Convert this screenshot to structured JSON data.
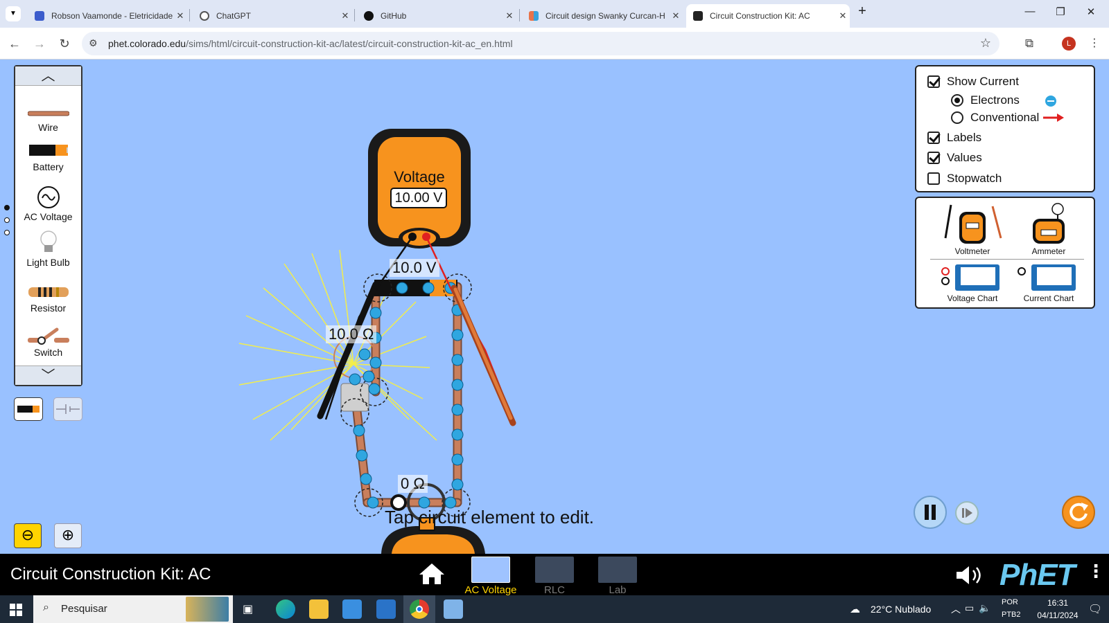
{
  "browser": {
    "tabs": [
      {
        "title": "Robson Vaamonde - Eletricidade",
        "favicon_color": "#3b5ccc"
      },
      {
        "title": "ChatGPT",
        "favicon_color": "#555555"
      },
      {
        "title": "GitHub",
        "favicon_color": "#111111"
      },
      {
        "title": "Circuit design Swanky Curcan-H",
        "favicon_color": "#e8734a"
      },
      {
        "title": "Circuit Construction Kit: AC",
        "favicon_color": "#222222"
      }
    ],
    "url_host": "phet.colorado.edu",
    "url_path": "/sims/html/circuit-construction-kit-ac/latest/circuit-construction-kit-ac_en.html",
    "profile_initial": "L"
  },
  "toolbox": {
    "items": [
      {
        "label": "Wire"
      },
      {
        "label": "Battery"
      },
      {
        "label": "AC Voltage"
      },
      {
        "label": "Light Bulb"
      },
      {
        "label": "Resistor"
      },
      {
        "label": "Switch"
      }
    ]
  },
  "controls": {
    "show_current": "Show Current",
    "electrons": "Electrons",
    "conventional": "Conventional",
    "labels": "Labels",
    "values": "Values",
    "stopwatch": "Stopwatch",
    "show_current_checked": true,
    "electrons_selected": true,
    "labels_checked": true,
    "values_checked": true,
    "stopwatch_checked": false
  },
  "sensors": {
    "voltmeter": "Voltmeter",
    "ammeter": "Ammeter",
    "voltage_chart": "Voltage Chart",
    "current_chart": "Current Chart"
  },
  "circuit": {
    "voltmeter_title": "Voltage",
    "voltmeter_reading": "10.00 V",
    "source_label": "10.0 V",
    "bulb_label": "10.0 Ω",
    "switch_label": "0 Ω",
    "hint": "Tap circuit element to edit."
  },
  "navbar": {
    "title": "Circuit Construction Kit: AC",
    "screens": [
      "AC Voltage",
      "RLC",
      "Lab"
    ],
    "active_screen": "AC Voltage",
    "logo": "PhET"
  },
  "taskbar": {
    "search_placeholder": "Pesquisar",
    "weather": "22°C  Nublado",
    "lang_top": "POR",
    "lang_bottom": "PTB2",
    "time": "16:31",
    "date": "04/11/2024"
  },
  "colors": {
    "sim_background": "#99c1ff",
    "meter_orange": "#f7931e",
    "wire_copper": "#c97f5c",
    "electron_blue": "#2fa6e0",
    "active_screen_yellow": "#ffd400"
  }
}
